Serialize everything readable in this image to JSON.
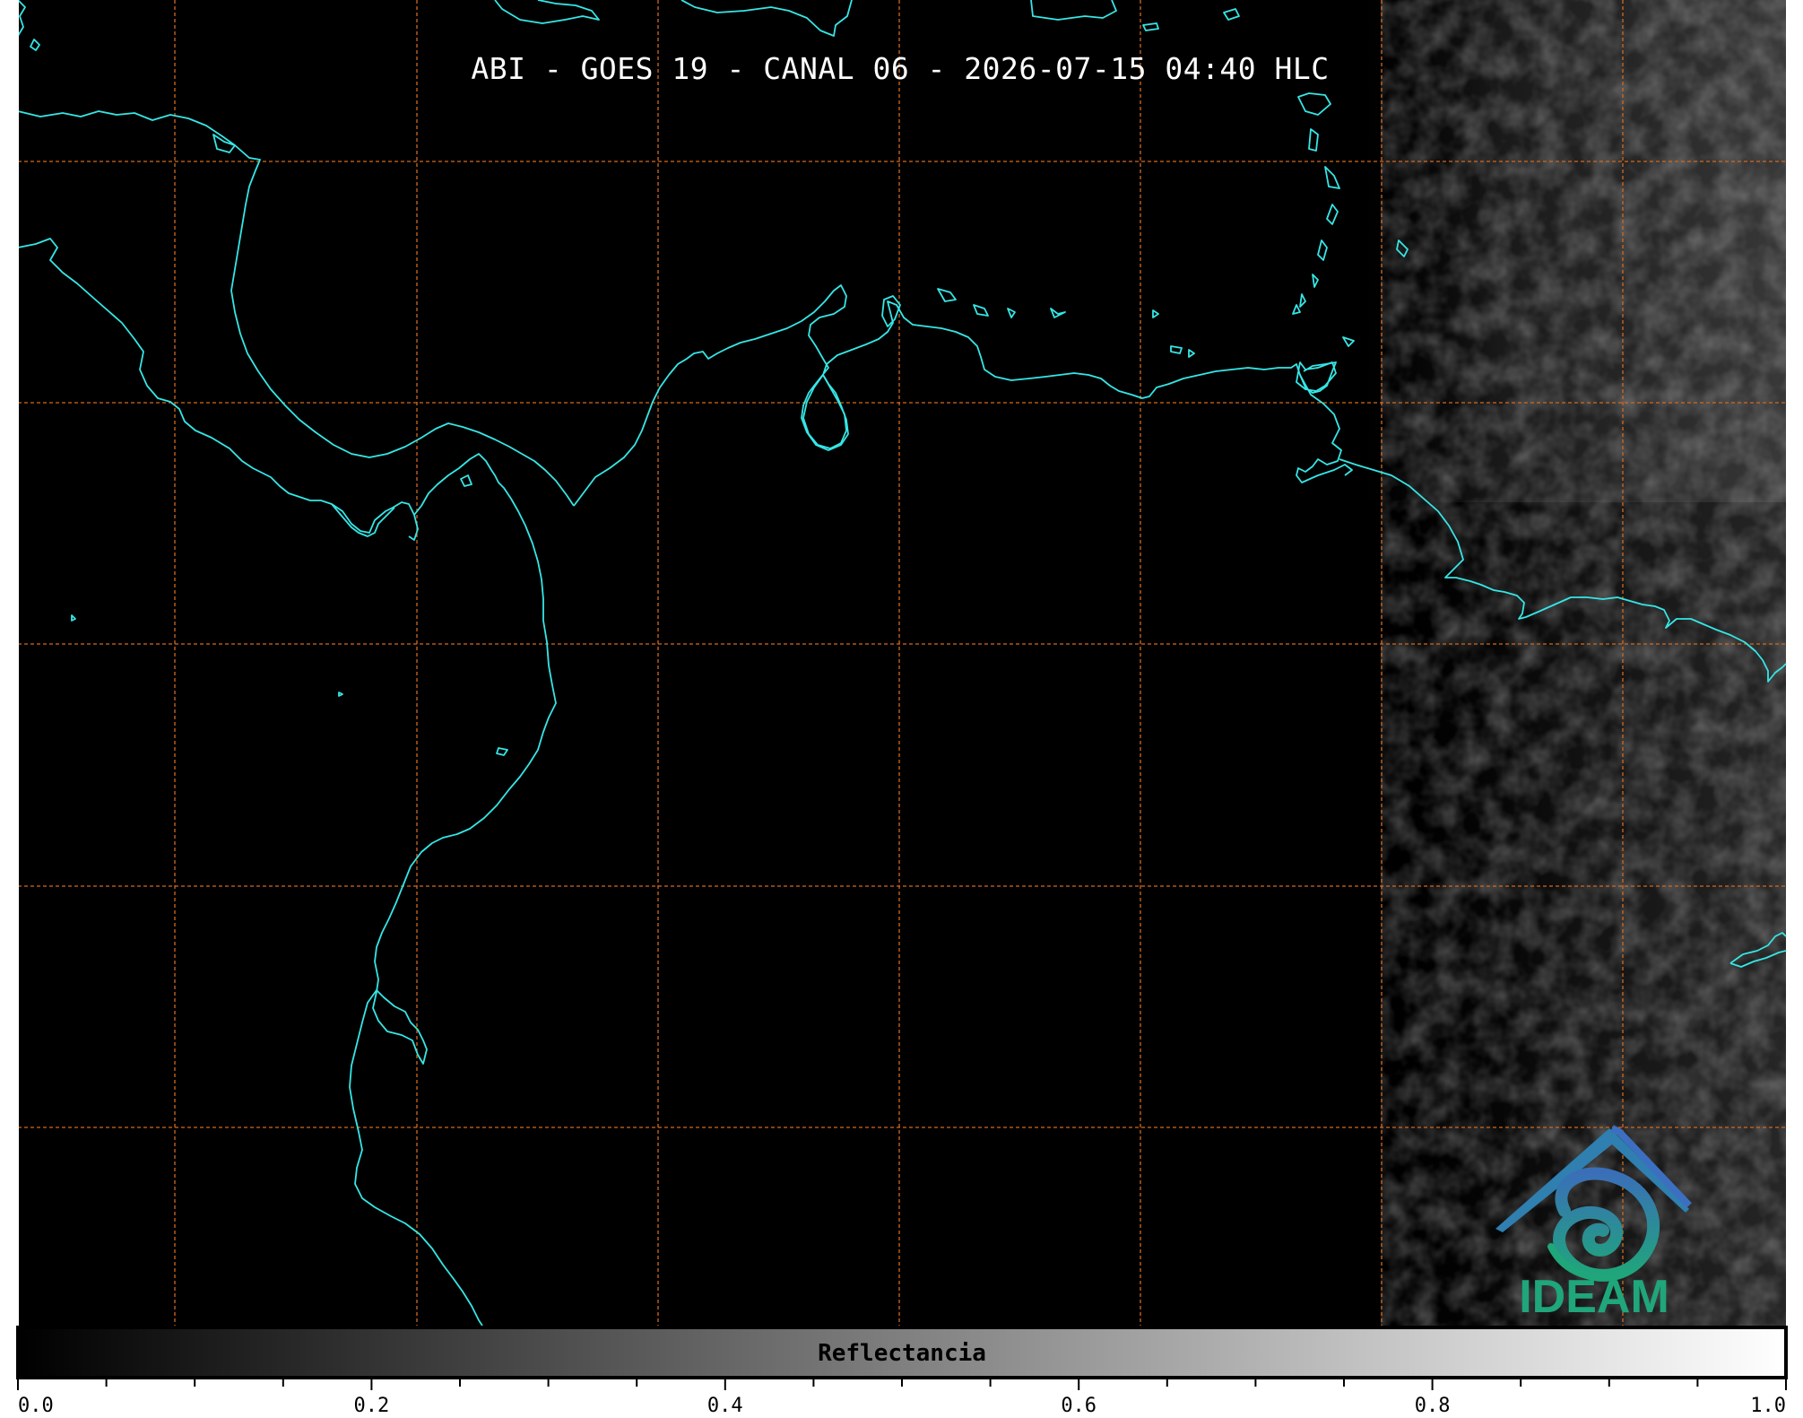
{
  "title": "ABI - GOES 19 - CANAL 06 - 2026-07-15 04:40 HLC",
  "colorbar": {
    "label": "Reflectancia",
    "min": 0.0,
    "max": 1.0,
    "major_ticks": [
      "0.0",
      "0.2",
      "0.4",
      "0.6",
      "0.8",
      "1.0"
    ],
    "minor_tick_step": 0.05,
    "colormap": "grayscale (black to white)"
  },
  "map": {
    "background_color": "#000000",
    "coastline_color": "#36e6e6",
    "gridline_color": "#d2691e",
    "gridline_style": "dashed",
    "cloud_region": "bright cloud texture along right edge (east)"
  },
  "logo": {
    "text": "IDEAM",
    "icon": "mountain-swirl-logo-icon",
    "color": "#1fa67a"
  }
}
